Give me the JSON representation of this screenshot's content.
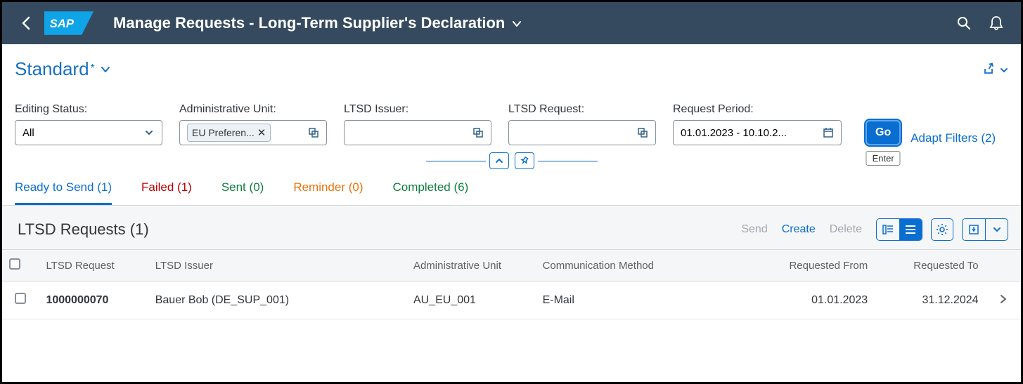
{
  "shell": {
    "title": "Manage Requests - Long-Term Supplier's Declaration"
  },
  "variant": {
    "name": "Standard",
    "dirty_marker": "*"
  },
  "filters": {
    "editing_status": {
      "label": "Editing Status:",
      "value": "All"
    },
    "admin_unit": {
      "label": "Administrative Unit:",
      "token": "EU Preferen..."
    },
    "ltsd_issuer": {
      "label": "LTSD Issuer:",
      "value": ""
    },
    "ltsd_request": {
      "label": "LTSD Request:",
      "value": ""
    },
    "request_period": {
      "label": "Request Period:",
      "value": "01.01.2023 - 10.10.2..."
    },
    "go_label": "Go",
    "go_tooltip": "Enter",
    "adapt_label": "Adapt Filters (2)"
  },
  "tabs": {
    "ready": {
      "label": "Ready to Send",
      "count": "(1)"
    },
    "failed": {
      "label": "Failed",
      "count": "(1)"
    },
    "sent": {
      "label": "Sent",
      "count": "(0)"
    },
    "reminder": {
      "label": "Reminder",
      "count": "(0)"
    },
    "completed": {
      "label": "Completed",
      "count": "(6)"
    }
  },
  "table": {
    "title": "LTSD Requests (1)",
    "actions": {
      "send": "Send",
      "create": "Create",
      "delete": "Delete"
    },
    "columns": {
      "request": "LTSD Request",
      "issuer": "LTSD Issuer",
      "admin_unit": "Administrative Unit",
      "comm": "Communication Method",
      "from": "Requested From",
      "to": "Requested To"
    },
    "row0": {
      "request": "1000000070",
      "issuer": "Bauer Bob (DE_SUP_001)",
      "admin_unit": "AU_EU_001",
      "comm": "E-Mail",
      "from": "01.01.2023",
      "to": "31.12.2024"
    }
  }
}
